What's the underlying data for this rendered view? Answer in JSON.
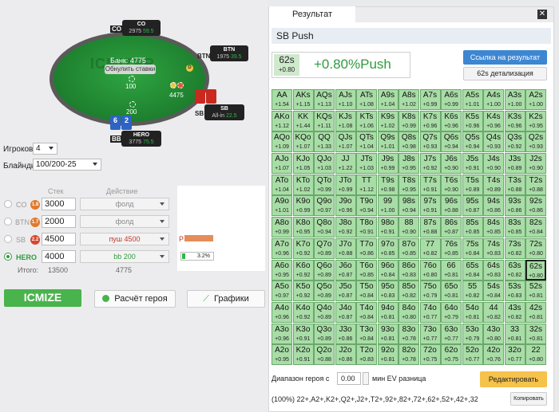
{
  "table": {
    "watermark": "ICMIZER",
    "bank": "Банк: 4775",
    "reset_label": "Обнулить ставки",
    "seats": [
      {
        "tag": "CO",
        "name": "CO",
        "stack": "2975",
        "bb": "59.5"
      },
      {
        "tag": "BTN",
        "name": "BTN",
        "stack": "1975",
        "bb": "39.5"
      },
      {
        "tag": "SB",
        "name": "SB",
        "stack": "All-in",
        "bb": "22.5"
      },
      {
        "tag": "BB",
        "name": "HERO",
        "stack": "3775",
        "bb": "75.5"
      }
    ],
    "bets": {
      "center": "100",
      "sb": "4475",
      "bb": "200"
    },
    "dealer_label": "D",
    "hero_cards": [
      {
        "rank": "6",
        "color": "blue"
      },
      {
        "rank": "2",
        "color": "blue"
      }
    ]
  },
  "settings": {
    "players_label": "Игроков",
    "players_value": "4",
    "blinds_label": "Блайнды",
    "blinds_value": "100/200-25"
  },
  "players_table": {
    "stack_header": "Стек",
    "action_header": "Действие",
    "rows": [
      {
        "pos": "CO",
        "badge": "1.8",
        "stack": "3000",
        "action": "фолд",
        "selected": false
      },
      {
        "pos": "BTN",
        "badge": "1.7",
        "stack": "2000",
        "action": "фолд",
        "selected": false
      },
      {
        "pos": "SB",
        "badge": "2.2",
        "stack": "4500",
        "action": "пуш 4500",
        "selected": false
      },
      {
        "pos": "HERO",
        "badge": "",
        "stack": "4000",
        "action": "bb 200",
        "selected": true
      }
    ],
    "total_label": "Итого:",
    "total_stack": "13500",
    "total_action": "4775"
  },
  "equity": {
    "label": "P",
    "value": "3.2%"
  },
  "buttons": {
    "icmize": "ICMIZE",
    "hero_calc": "Расчёт героя",
    "charts": "Графики"
  },
  "panel": {
    "tab_label": "Результат",
    "close_label": "✕",
    "title": "SB Push",
    "result_hand": "62s",
    "result_value": "+0.80",
    "result_ev": "+0.80%Push",
    "link_button": "Ссылка на результат",
    "detail_button": "62s детализация",
    "range_label": "Диапазон героя с",
    "range_value": "0.00",
    "range_suffix": "мин EV разница",
    "edit_button": "Редактировать",
    "range_text": "(100%) 22+,A2+,K2+,Q2+,J2+,T2+,92+,82+,72+,62+,52+,42+,32",
    "copy_button": "Копировать",
    "highlight": "62s"
  },
  "grid": [
    [
      [
        "AA",
        "+1.54"
      ],
      [
        "AKs",
        "+1.15"
      ],
      [
        "AQs",
        "+1.13"
      ],
      [
        "AJs",
        "+1.10"
      ],
      [
        "ATs",
        "+1.08"
      ],
      [
        "A9s",
        "+1.04"
      ],
      [
        "A8s",
        "+1.02"
      ],
      [
        "A7s",
        "+0.99"
      ],
      [
        "A6s",
        "+0.99"
      ],
      [
        "A5s",
        "+1.01"
      ],
      [
        "A4s",
        "+1.00"
      ],
      [
        "A3s",
        "+1.00"
      ],
      [
        "A2s",
        "+1.00"
      ]
    ],
    [
      [
        "AKo",
        "+1.12"
      ],
      [
        "KK",
        "+1.44"
      ],
      [
        "KQs",
        "+1.11"
      ],
      [
        "KJs",
        "+1.08"
      ],
      [
        "KTs",
        "+1.06"
      ],
      [
        "K9s",
        "+1.02"
      ],
      [
        "K8s",
        "+0.99"
      ],
      [
        "K7s",
        "+0.96"
      ],
      [
        "K6s",
        "+0.96"
      ],
      [
        "K5s",
        "+0.96"
      ],
      [
        "K4s",
        "+0.96"
      ],
      [
        "K3s",
        "+0.96"
      ],
      [
        "K2s",
        "+0.95"
      ]
    ],
    [
      [
        "AQo",
        "+1.09"
      ],
      [
        "KQo",
        "+1.07"
      ],
      [
        "QQ",
        "+1.33"
      ],
      [
        "QJs",
        "+1.07"
      ],
      [
        "QTs",
        "+1.04"
      ],
      [
        "Q9s",
        "+1.01"
      ],
      [
        "Q8s",
        "+0.98"
      ],
      [
        "Q7s",
        "+0.93"
      ],
      [
        "Q6s",
        "+0.94"
      ],
      [
        "Q5s",
        "+0.94"
      ],
      [
        "Q4s",
        "+0.93"
      ],
      [
        "Q3s",
        "+0.92"
      ],
      [
        "Q2s",
        "+0.93"
      ]
    ],
    [
      [
        "AJo",
        "+1.07"
      ],
      [
        "KJo",
        "+1.05"
      ],
      [
        "QJo",
        "+1.03"
      ],
      [
        "JJ",
        "+1.22"
      ],
      [
        "JTs",
        "+1.03"
      ],
      [
        "J9s",
        "+0.99"
      ],
      [
        "J8s",
        "+0.95"
      ],
      [
        "J7s",
        "+0.92"
      ],
      [
        "J6s",
        "+0.90"
      ],
      [
        "J5s",
        "+0.91"
      ],
      [
        "J4s",
        "+0.90"
      ],
      [
        "J3s",
        "+0.89"
      ],
      [
        "J2s",
        "+0.90"
      ]
    ],
    [
      [
        "ATo",
        "+1.04"
      ],
      [
        "KTo",
        "+1.02"
      ],
      [
        "QTo",
        "+0.99"
      ],
      [
        "JTo",
        "+0.99"
      ],
      [
        "TT",
        "+1.12"
      ],
      [
        "T9s",
        "+0.98"
      ],
      [
        "T8s",
        "+0.95"
      ],
      [
        "T7s",
        "+0.91"
      ],
      [
        "T6s",
        "+0.90"
      ],
      [
        "T5s",
        "+0.89"
      ],
      [
        "T4s",
        "+0.89"
      ],
      [
        "T3s",
        "+0.88"
      ],
      [
        "T2s",
        "+0.88"
      ]
    ],
    [
      [
        "A9o",
        "+1.01"
      ],
      [
        "K9o",
        "+0.99"
      ],
      [
        "Q9o",
        "+0.97"
      ],
      [
        "J9o",
        "+0.96"
      ],
      [
        "T9o",
        "+0.94"
      ],
      [
        "99",
        "+1.00"
      ],
      [
        "98s",
        "+0.94"
      ],
      [
        "97s",
        "+0.91"
      ],
      [
        "96s",
        "+0.88"
      ],
      [
        "95s",
        "+0.87"
      ],
      [
        "94s",
        "+0.86"
      ],
      [
        "93s",
        "+0.86"
      ],
      [
        "92s",
        "+0.86"
      ]
    ],
    [
      [
        "A8o",
        "+0.99"
      ],
      [
        "K8o",
        "+0.95"
      ],
      [
        "Q8o",
        "+0.94"
      ],
      [
        "J8o",
        "+0.92"
      ],
      [
        "T8o",
        "+0.91"
      ],
      [
        "98o",
        "+0.91"
      ],
      [
        "88",
        "+0.90"
      ],
      [
        "87s",
        "+0.88"
      ],
      [
        "86s",
        "+0.87"
      ],
      [
        "85s",
        "+0.85"
      ],
      [
        "84s",
        "+0.85"
      ],
      [
        "83s",
        "+0.85"
      ],
      [
        "82s",
        "+0.84"
      ]
    ],
    [
      [
        "A7o",
        "+0.96"
      ],
      [
        "K7o",
        "+0.92"
      ],
      [
        "Q7o",
        "+0.89"
      ],
      [
        "J7o",
        "+0.88"
      ],
      [
        "T7o",
        "+0.86"
      ],
      [
        "97o",
        "+0.85"
      ],
      [
        "87o",
        "+0.85"
      ],
      [
        "77",
        "+0.82"
      ],
      [
        "76s",
        "+0.85"
      ],
      [
        "75s",
        "+0.84"
      ],
      [
        "74s",
        "+0.83"
      ],
      [
        "73s",
        "+0.82"
      ],
      [
        "72s",
        "+0.80"
      ]
    ],
    [
      [
        "A6o",
        "+0.95"
      ],
      [
        "K6o",
        "+0.92"
      ],
      [
        "Q6o",
        "+0.89"
      ],
      [
        "J6o",
        "+0.87"
      ],
      [
        "T6o",
        "+0.85"
      ],
      [
        "96o",
        "+0.84"
      ],
      [
        "86o",
        "+0.83"
      ],
      [
        "76o",
        "+0.80"
      ],
      [
        "66",
        "+0.81"
      ],
      [
        "65s",
        "+0.84"
      ],
      [
        "64s",
        "+0.83"
      ],
      [
        "63s",
        "+0.82"
      ],
      [
        "62s",
        "+0.80"
      ]
    ],
    [
      [
        "A5o",
        "+0.97"
      ],
      [
        "K5o",
        "+0.92"
      ],
      [
        "Q5o",
        "+0.89"
      ],
      [
        "J5o",
        "+0.87"
      ],
      [
        "T5o",
        "+0.84"
      ],
      [
        "95o",
        "+0.83"
      ],
      [
        "85o",
        "+0.82"
      ],
      [
        "75o",
        "+0.79"
      ],
      [
        "65o",
        "+0.81"
      ],
      [
        "55",
        "+0.82"
      ],
      [
        "54s",
        "+0.84"
      ],
      [
        "53s",
        "+0.83"
      ],
      [
        "52s",
        "+0.81"
      ]
    ],
    [
      [
        "A4o",
        "+0.96"
      ],
      [
        "K4o",
        "+0.92"
      ],
      [
        "Q4o",
        "+0.89"
      ],
      [
        "J4o",
        "+0.87"
      ],
      [
        "T4o",
        "+0.84"
      ],
      [
        "94o",
        "+0.81"
      ],
      [
        "84o",
        "+0.80"
      ],
      [
        "74o",
        "+0.77"
      ],
      [
        "64o",
        "+0.79"
      ],
      [
        "54o",
        "+0.81"
      ],
      [
        "44",
        "+0.82"
      ],
      [
        "43s",
        "+0.82"
      ],
      [
        "42s",
        "+0.81"
      ]
    ],
    [
      [
        "A3o",
        "+0.96"
      ],
      [
        "K3o",
        "+0.91"
      ],
      [
        "Q3o",
        "+0.89"
      ],
      [
        "J3o",
        "+0.86"
      ],
      [
        "T3o",
        "+0.84"
      ],
      [
        "93o",
        "+0.81"
      ],
      [
        "83o",
        "+0.78"
      ],
      [
        "73o",
        "+0.77"
      ],
      [
        "63o",
        "+0.77"
      ],
      [
        "53o",
        "+0.79"
      ],
      [
        "43o",
        "+0.80"
      ],
      [
        "33",
        "+0.81"
      ],
      [
        "32s",
        "+0.81"
      ]
    ],
    [
      [
        "A2o",
        "+0.95"
      ],
      [
        "K2o",
        "+0.91"
      ],
      [
        "Q2o",
        "+0.88"
      ],
      [
        "J2o",
        "+0.86"
      ],
      [
        "T2o",
        "+0.83"
      ],
      [
        "92o",
        "+0.81"
      ],
      [
        "82o",
        "+0.78"
      ],
      [
        "72o",
        "+0.75"
      ],
      [
        "62o",
        "+0.75"
      ],
      [
        "52o",
        "+0.77"
      ],
      [
        "42o",
        "+0.76"
      ],
      [
        "32o",
        "+0.77"
      ],
      [
        "22",
        "+0.80"
      ]
    ]
  ]
}
